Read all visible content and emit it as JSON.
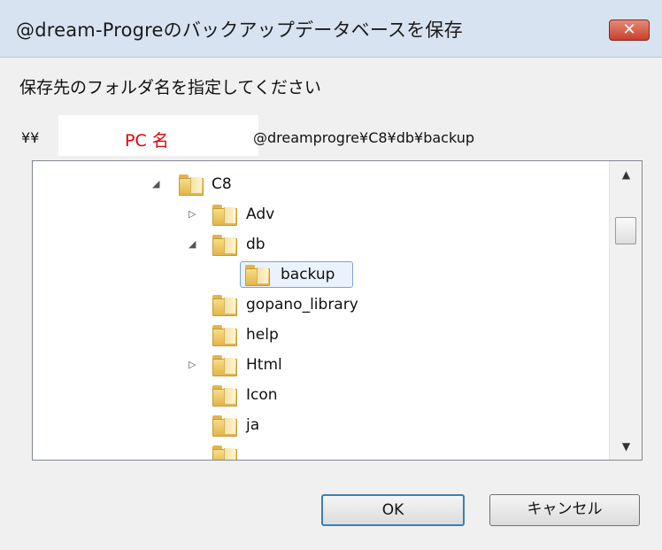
{
  "window": {
    "title": "@dream-Progreのバックアップデータベースを保存",
    "close_symbol": "✕"
  },
  "prompt": "保存先のフォルダ名を指定してください",
  "path": {
    "prefix": "¥¥",
    "pc_name": "PC 名",
    "rest": "@dreamprogre¥C8¥db¥backup"
  },
  "tree": {
    "items": [
      {
        "label": "C8",
        "expander": "◢"
      },
      {
        "label": "Adv",
        "expander": "▷"
      },
      {
        "label": "db",
        "expander": "◢"
      },
      {
        "label": "backup",
        "expander": ""
      },
      {
        "label": "gopano_library",
        "expander": ""
      },
      {
        "label": "help",
        "expander": ""
      },
      {
        "label": "Html",
        "expander": "▷"
      },
      {
        "label": "Icon",
        "expander": ""
      },
      {
        "label": "ja",
        "expander": ""
      }
    ],
    "selected": "backup"
  },
  "scrollbar": {
    "up_arrow": "▲",
    "down_arrow": "▼"
  },
  "buttons": {
    "ok": "OK",
    "cancel": "キャンセル"
  }
}
